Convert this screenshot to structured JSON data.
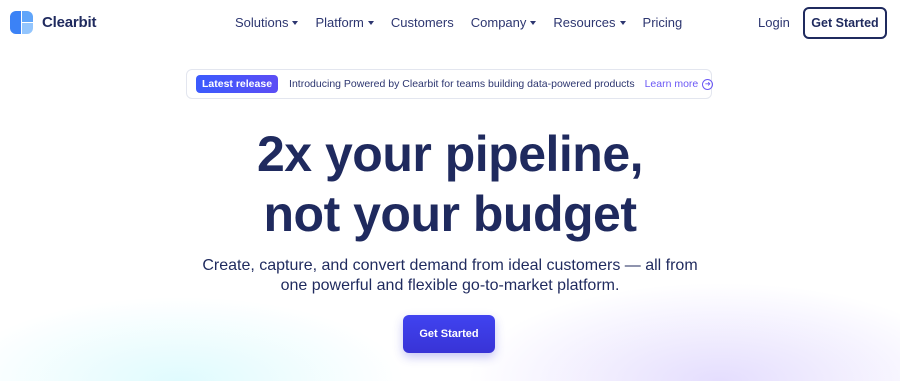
{
  "brand": {
    "name": "Clearbit",
    "colors": {
      "primary": "#3b82f6",
      "dark": "#1f2a5e",
      "accent": "#6b58f5"
    }
  },
  "nav": {
    "items": [
      {
        "label": "Solutions",
        "has_dropdown": true
      },
      {
        "label": "Platform",
        "has_dropdown": true
      },
      {
        "label": "Customers",
        "has_dropdown": false
      },
      {
        "label": "Company",
        "has_dropdown": true
      },
      {
        "label": "Resources",
        "has_dropdown": true
      },
      {
        "label": "Pricing",
        "has_dropdown": false
      }
    ],
    "login_label": "Login",
    "cta_label": "Get Started"
  },
  "banner": {
    "badge": "Latest release",
    "text": "Introducing Powered by Clearbit for teams building data-powered products",
    "link_label": "Learn more",
    "link_icon": "arrow-circle-right-icon"
  },
  "hero": {
    "headline_line1": "2x your pipeline,",
    "headline_line2": "not your budget",
    "subtext_line1": "Create, capture, and convert demand from ideal customers — all from",
    "subtext_line2": "one powerful and flexible go-to-market platform.",
    "cta_label": "Get Started"
  }
}
